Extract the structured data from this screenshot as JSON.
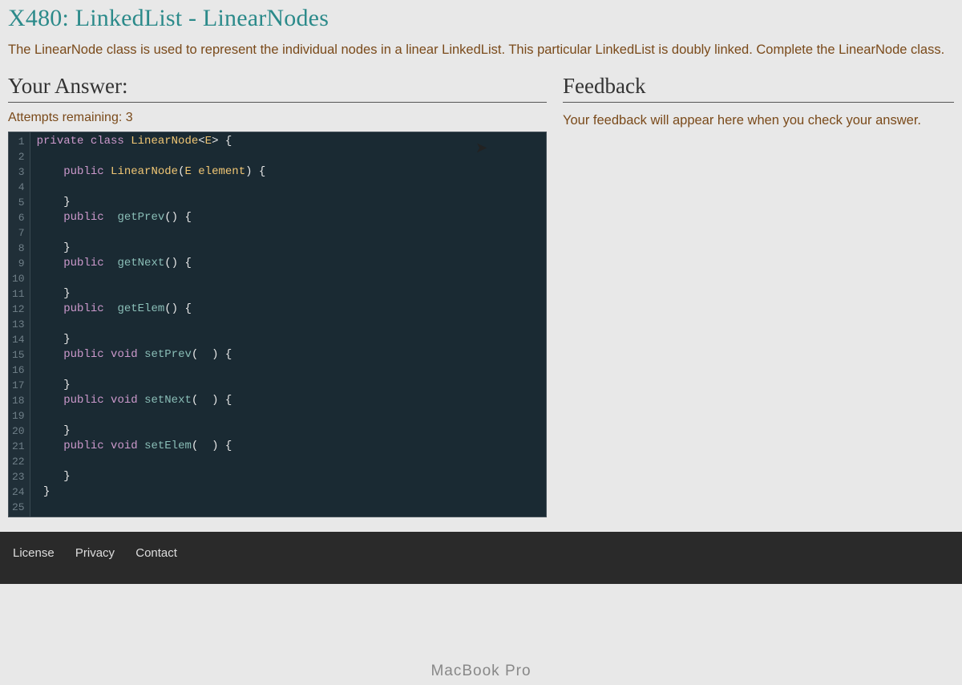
{
  "title": "X480: LinkedList - LinearNodes",
  "description": "The LinearNode class is used to represent the individual nodes in a linear LinkedList. This particular LinkedList is doubly linked. Complete the LinearNode class.",
  "your_answer_heading": "Your Answer:",
  "attempts_label": "Attempts remaining: 3",
  "feedback_heading": "Feedback",
  "feedback_text": "Your feedback will appear here when you check your answer.",
  "code_lines": [
    "private class LinearNode<E> {",
    "",
    "    public LinearNode(E element) {",
    "",
    "    }",
    "    public  getPrev() {",
    "",
    "    }",
    "    public  getNext() {",
    "",
    "    }",
    "    public  getElem() {",
    "",
    "    }",
    "    public void setPrev(  ) {",
    "",
    "    }",
    "    public void setNext(  ) {",
    "",
    "    }",
    "    public void setElem(  ) {",
    "",
    "    }",
    " }",
    ""
  ],
  "footer": {
    "license": "License",
    "privacy": "Privacy",
    "contact": "Contact"
  },
  "macbook": "MacBook Pro"
}
